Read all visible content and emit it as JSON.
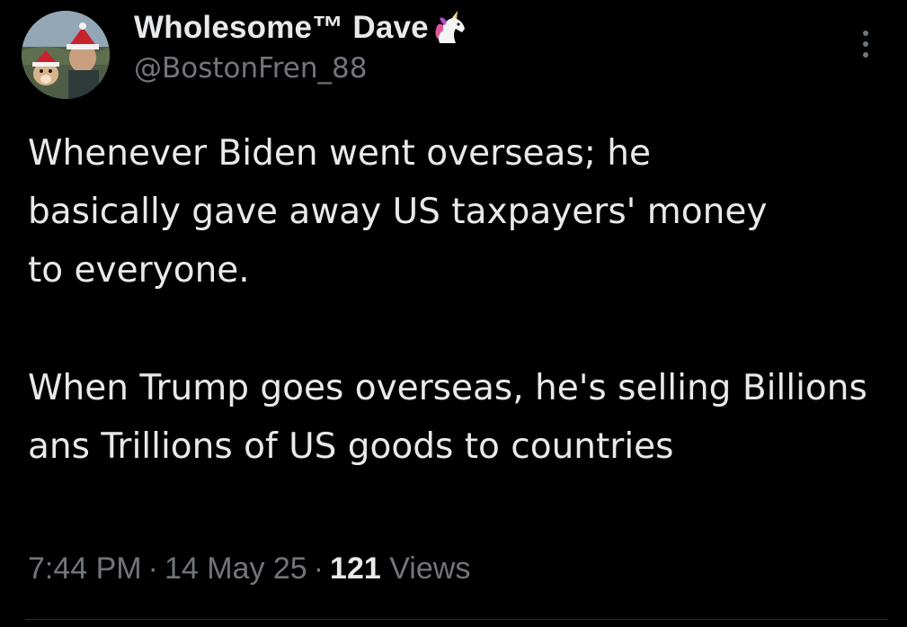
{
  "post": {
    "author": {
      "display_name": "Wholesome™ Dave",
      "name_emoji": "unicorn-icon",
      "handle": "@BostonFren_88",
      "avatar": "avatar-photo"
    },
    "menu_icon": "more-vertical-icon",
    "text": {
      "paragraph_1": "Whenever Biden went overseas; he basically gave away US taxpayers' money to everyone.",
      "paragraph_2": "When Trump goes overseas, he's selling Billions ans Trillions of US goods to countries"
    },
    "meta": {
      "time": "7:44 PM",
      "date": "14 May 25",
      "separator": "·",
      "views_count": "121",
      "views_label": "Views"
    }
  },
  "colors": {
    "background": "#000000",
    "primary_text": "#e7e9ea",
    "secondary_text": "#71767b",
    "divider": "#2f3336"
  }
}
